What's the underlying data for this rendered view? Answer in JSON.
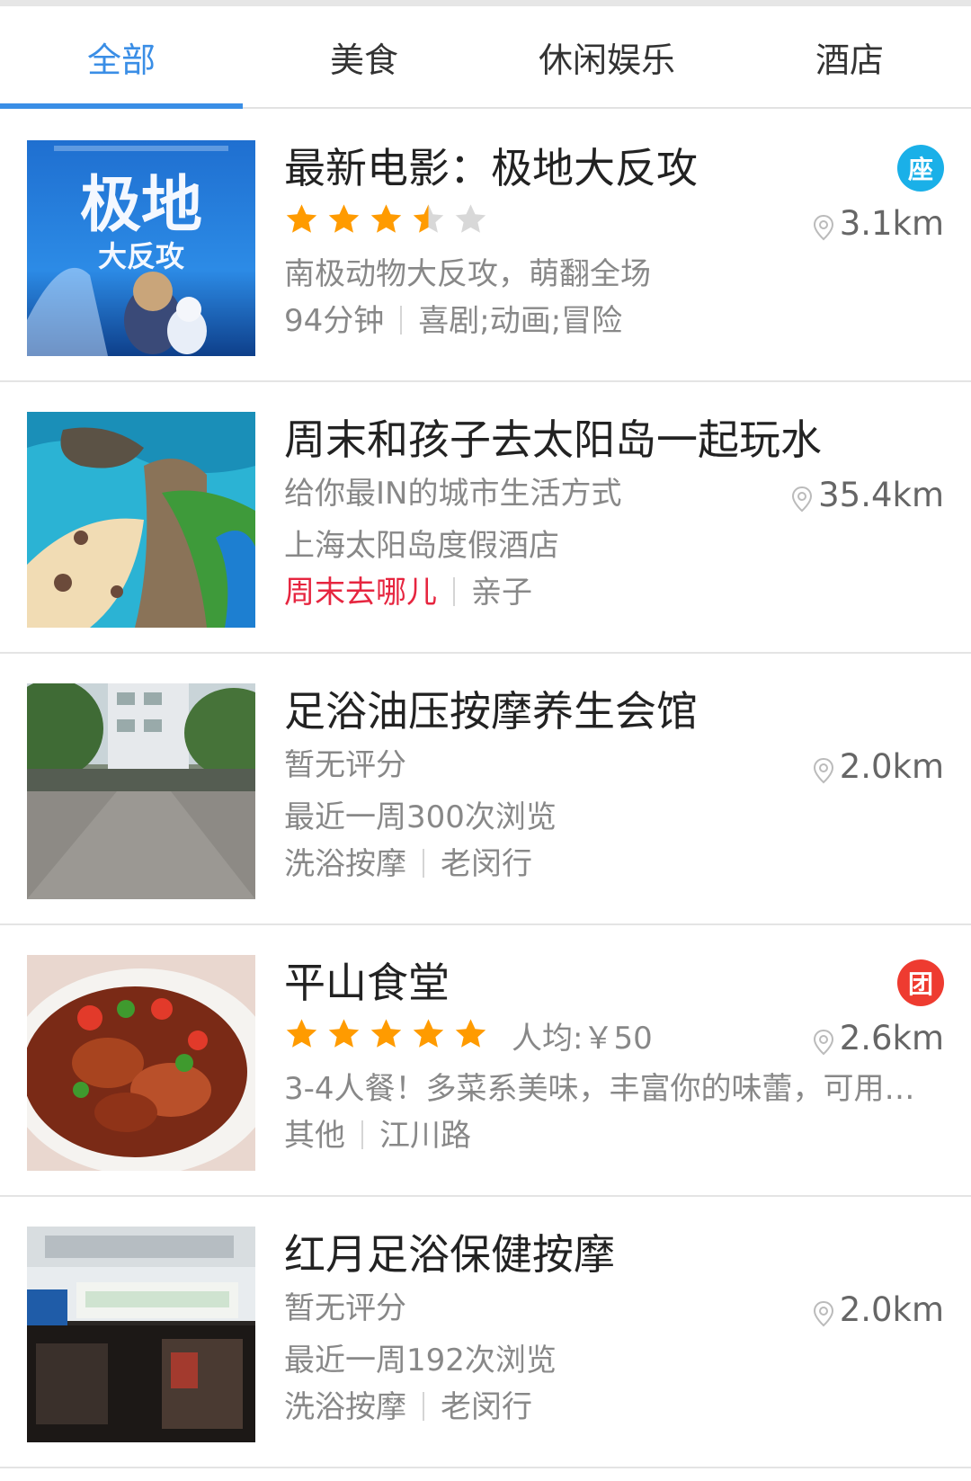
{
  "tabs": [
    {
      "label": "全部",
      "active": true
    },
    {
      "label": "美食",
      "active": false
    },
    {
      "label": "休闲娱乐",
      "active": false
    },
    {
      "label": "酒店",
      "active": false
    }
  ],
  "colors": {
    "accent": "#3a8ee6",
    "star": "#ff9b00",
    "star_empty": "#d8d8d8",
    "hot": "#e6253f",
    "badge_seat": "#1ab0e8",
    "badge_group": "#ee3b30"
  },
  "items": [
    {
      "title": "最新电影：极地大反攻",
      "rating": 3.5,
      "distance": "3.1km",
      "badge": "座",
      "desc": "南极动物大反攻，萌翻全场",
      "meta1": "94分钟",
      "meta2": "喜剧;动画;冒险",
      "poster_text_1": "极地",
      "poster_text_2": "大反攻"
    },
    {
      "title": "周末和孩子去太阳岛一起玩水",
      "subtitle": "给你最IN的城市生活方式",
      "distance": "35.4km",
      "venue": "上海太阳岛度假酒店",
      "tag_hot": "周末去哪儿",
      "tag": "亲子"
    },
    {
      "title": "足浴油压按摩养生会馆",
      "rating_text": "暂无评分",
      "distance": "2.0km",
      "views": "最近一周300次浏览",
      "category": "洗浴按摩",
      "area": "老闵行"
    },
    {
      "title": "平山食堂",
      "rating": 5,
      "price": "人均:￥50",
      "distance": "2.6km",
      "badge": "团",
      "desc": "3-4人餐！多菜系美味，丰富你的味蕾，可用…",
      "category": "其他",
      "area": "江川路"
    },
    {
      "title": "红月足浴保健按摩",
      "rating_text": "暂无评分",
      "distance": "2.0km",
      "views": "最近一周192次浏览",
      "category": "洗浴按摩",
      "area": "老闵行"
    }
  ]
}
